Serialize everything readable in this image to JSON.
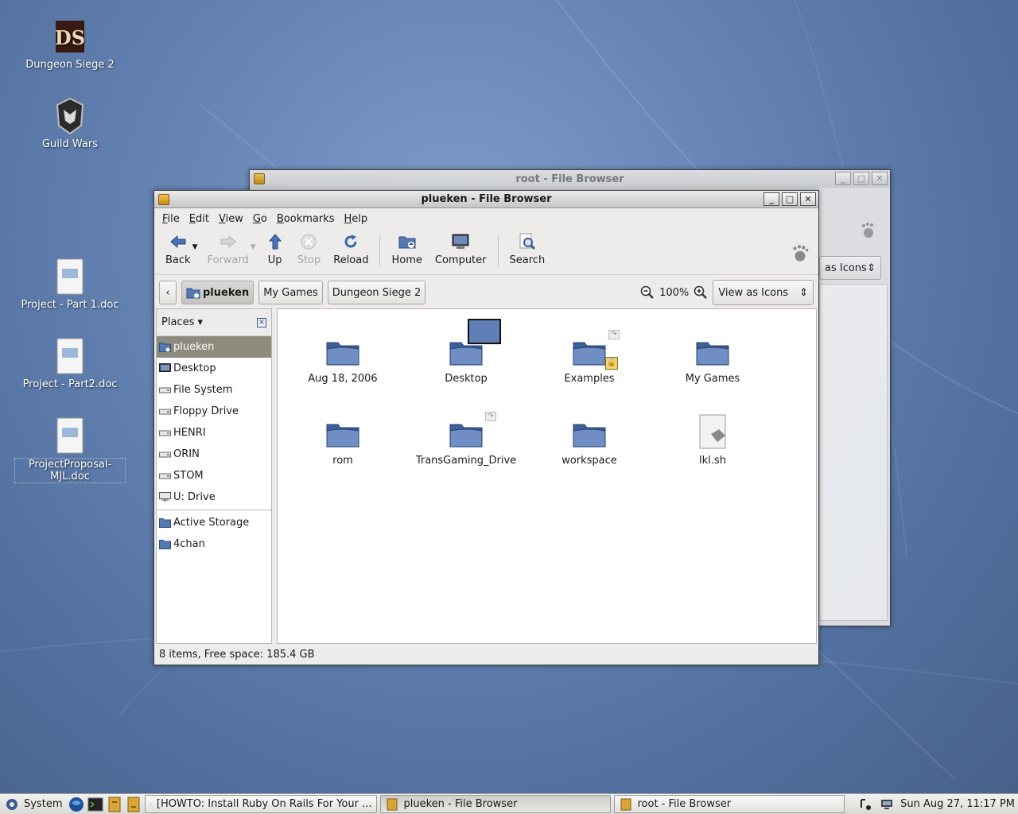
{
  "desktop": {
    "icons": [
      {
        "label": "Dungeon Siege 2",
        "icon": "dungeon-siege-logo"
      },
      {
        "label": "Guild Wars",
        "icon": "guild-wars-helmet"
      },
      {
        "label": "Project - Part 1.doc",
        "icon": "document-icon"
      },
      {
        "label": "Project - Part2.doc",
        "icon": "document-icon"
      },
      {
        "label": "ProjectProposal-MJL.doc",
        "icon": "document-icon"
      }
    ],
    "ds_logo_text": "DS"
  },
  "back_window": {
    "title": "root - File Browser",
    "view_select_partial": "as Icons"
  },
  "window": {
    "title": "plueken - File Browser",
    "menu": [
      {
        "label": "File",
        "key": "F",
        "rest": "ile"
      },
      {
        "label": "Edit",
        "key": "E",
        "rest": "dit"
      },
      {
        "label": "View",
        "key": "V",
        "rest": "iew"
      },
      {
        "label": "Go",
        "key": "G",
        "rest": "o"
      },
      {
        "label": "Bookmarks",
        "key": "B",
        "rest": "ookmarks"
      },
      {
        "label": "Help",
        "key": "H",
        "rest": "elp"
      }
    ],
    "toolbar": {
      "back": "Back",
      "forward": "Forward",
      "up": "Up",
      "stop": "Stop",
      "reload": "Reload",
      "home": "Home",
      "computer": "Computer",
      "search": "Search"
    },
    "breadcrumbs": [
      "plueken",
      "My Games",
      "Dungeon Siege 2"
    ],
    "zoom": "100%",
    "view_mode": "View as Icons",
    "places_label": "Places",
    "places": [
      {
        "label": "plueken",
        "icon": "home-folder-icon",
        "selected": true
      },
      {
        "label": "Desktop",
        "icon": "desktop-icon"
      },
      {
        "label": "File System",
        "icon": "drive-icon"
      },
      {
        "label": "Floppy Drive",
        "icon": "floppy-icon"
      },
      {
        "label": "HENRI",
        "icon": "drive-icon"
      },
      {
        "label": "ORIN",
        "icon": "drive-icon"
      },
      {
        "label": "STOM",
        "icon": "drive-icon"
      },
      {
        "label": "U: Drive",
        "icon": "network-drive-icon"
      }
    ],
    "bookmarks": [
      {
        "label": "Active Storage",
        "icon": "folder-icon"
      },
      {
        "label": "4chan",
        "icon": "folder-icon"
      }
    ],
    "files": [
      {
        "name": "Aug 18, 2006",
        "type": "folder"
      },
      {
        "name": "Desktop",
        "type": "folder"
      },
      {
        "name": "Examples",
        "type": "folder-link"
      },
      {
        "name": "My Games",
        "type": "folder"
      },
      {
        "name": "rom",
        "type": "folder"
      },
      {
        "name": "TransGaming_Drive",
        "type": "folder-link"
      },
      {
        "name": "workspace",
        "type": "folder"
      },
      {
        "name": "lkl.sh",
        "type": "script"
      }
    ],
    "status": "8 items, Free space: 185.4 GB"
  },
  "taskbar": {
    "system_label": "System",
    "tasks": [
      {
        "label": "[HOWTO: Install Ruby On Rails For Your ...",
        "icon": "browser-icon"
      },
      {
        "label": "plueken - File Browser",
        "icon": "file-browser-icon",
        "active": true
      },
      {
        "label": "root - File Browser",
        "icon": "file-browser-icon"
      }
    ],
    "clock": "Sun Aug 27, 11:17 PM"
  }
}
